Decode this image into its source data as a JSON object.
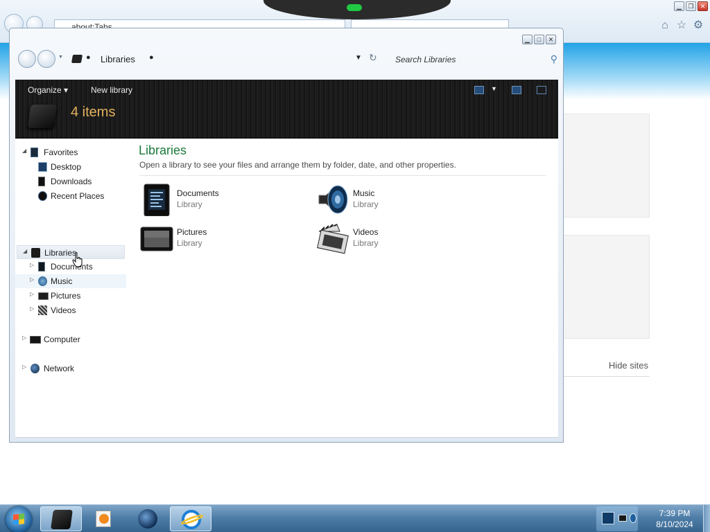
{
  "browser": {
    "address": "about:Tabs",
    "hide_sites": "Hide sites"
  },
  "explorer": {
    "breadcrumb": "Libraries",
    "search_placeholder": "Search Libraries",
    "toolbar": {
      "organize": "Organize ▾",
      "new_library": "New library"
    },
    "header_count": "4 items",
    "nav": {
      "favorites": "Favorites",
      "desktop": "Desktop",
      "downloads": "Downloads",
      "recent_places": "Recent Places",
      "libraries": "Libraries",
      "documents": "Documents",
      "music": "Music",
      "pictures": "Pictures",
      "videos": "Videos",
      "computer": "Computer",
      "network": "Network"
    },
    "content": {
      "title": "Libraries",
      "subtitle": "Open a library to see your files and arrange them by folder, date, and other properties.",
      "items": [
        {
          "name": "Documents",
          "kind": "Library",
          "icon": "documents-library-icon"
        },
        {
          "name": "Music",
          "kind": "Library",
          "icon": "music-library-icon"
        },
        {
          "name": "Pictures",
          "kind": "Library",
          "icon": "pictures-library-icon"
        },
        {
          "name": "Videos",
          "kind": "Library",
          "icon": "videos-library-icon"
        }
      ]
    }
  },
  "taskbar": {
    "time": "7:39 PM",
    "date": "8/10/2024"
  },
  "colors": {
    "accent_blue": "#22a3e6",
    "library_title_green": "#1a7a3a",
    "header_count_orange": "#e2b15c",
    "toolbar_dark": "#161616"
  }
}
